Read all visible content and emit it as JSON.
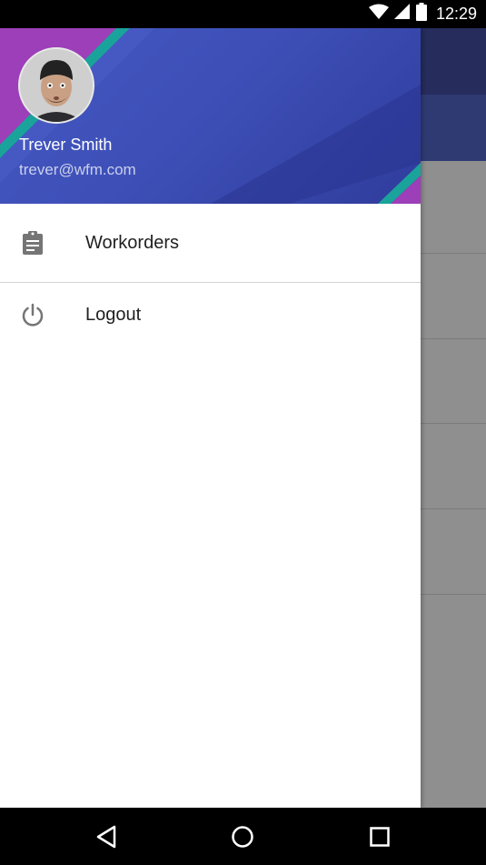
{
  "status_bar": {
    "time": "12:29"
  },
  "drawer": {
    "header": {
      "user_name": "Trever Smith",
      "user_email": "trever@wfm.com"
    },
    "menu": [
      {
        "label": "Workorders",
        "icon": "clipboard-icon"
      },
      {
        "label": "Logout",
        "icon": "power-icon"
      }
    ]
  },
  "colors": {
    "header_blue": "#3e50b8",
    "accent_teal": "#1aa39a",
    "accent_purple": "#9c3fb8"
  }
}
